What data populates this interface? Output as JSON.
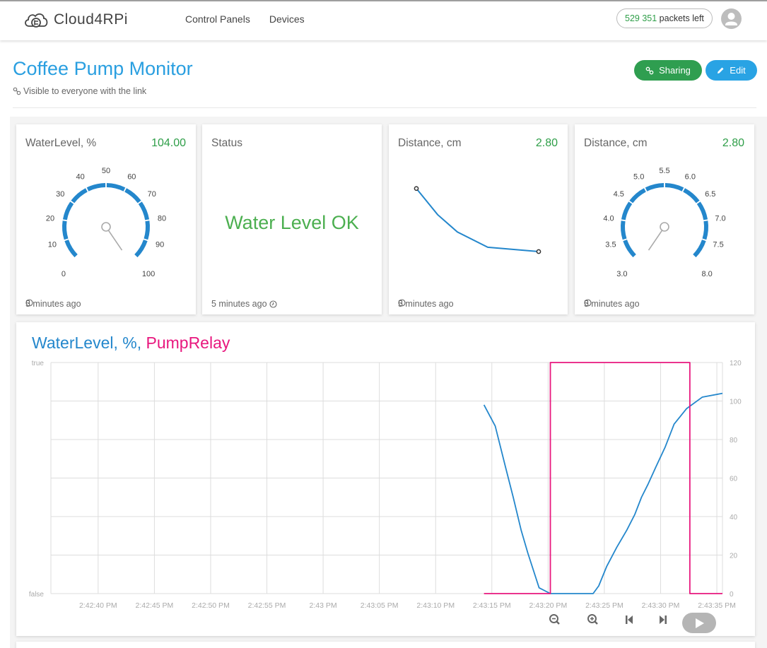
{
  "header": {
    "brand": "Cloud4RPi",
    "logo_icon": "cloud-plug-icon",
    "nav": [
      {
        "label": "Control Panels"
      },
      {
        "label": "Devices"
      }
    ],
    "packets": {
      "count": "529 351",
      "suffix": " packets left"
    },
    "avatar_icon": "user-avatar-icon"
  },
  "page": {
    "title": "Coffee Pump Monitor",
    "visibility": "Visible to everyone with the link",
    "visibility_icon": "link-icon",
    "buttons": {
      "sharing": {
        "label": "Sharing",
        "icon": "link-icon",
        "color": "#2f9e50"
      },
      "edit": {
        "label": "Edit",
        "icon": "pencil-icon",
        "color": "#29a3e4"
      }
    }
  },
  "widgets": [
    {
      "type": "gauge",
      "title": "WaterLevel, %",
      "value": "104.00",
      "numeric_value": 104,
      "min": 0,
      "max": 100,
      "tick_labels": [
        "0",
        "10",
        "20",
        "30",
        "40",
        "50",
        "60",
        "70",
        "80",
        "90",
        "100"
      ],
      "updated": "5 minutes ago"
    },
    {
      "type": "text",
      "title": "Status",
      "text": "Water Level OK",
      "updated": "5 minutes ago"
    },
    {
      "type": "sparkline",
      "title": "Distance, cm",
      "value": "2.80",
      "points": [
        4.5,
        3.9,
        3.5,
        3.15,
        3.05
      ],
      "updated": "5 minutes ago"
    },
    {
      "type": "gauge",
      "title": "Distance, cm",
      "value": "2.80",
      "numeric_value": 2.8,
      "min": 3.0,
      "max": 8.0,
      "tick_labels": [
        "3.0",
        "3.5",
        "4.0",
        "4.5",
        "5.0",
        "5.5",
        "6.0",
        "6.5",
        "7.0",
        "7.5",
        "8.0"
      ],
      "updated": "5 minutes ago"
    }
  ],
  "colors": {
    "accent_blue": "#2487cc",
    "accent_pink": "#e8177e",
    "value_green": "#2e9e48",
    "status_green": "#4caf50"
  },
  "chart": {
    "controls": [
      {
        "name": "zoom-out",
        "icon": "zoom-out-icon"
      },
      {
        "name": "zoom-in",
        "icon": "zoom-in-icon"
      },
      {
        "name": "skip-back",
        "icon": "skip-to-start-icon"
      },
      {
        "name": "skip-forward",
        "icon": "skip-to-end-icon"
      },
      {
        "name": "play",
        "icon": "play-icon"
      }
    ]
  },
  "chart_data": {
    "type": "line",
    "title_parts": [
      {
        "text": "WaterLevel, %, ",
        "color": "#2487cc"
      },
      {
        "text": "PumpRelay",
        "color": "#e8177e"
      }
    ],
    "x_unit": "seconds after 2:42:35 PM",
    "xlim": [
      0.8,
      60.5
    ],
    "x_ticks": [
      {
        "t": 5,
        "label": "2:42:40 PM"
      },
      {
        "t": 10,
        "label": "2:42:45 PM"
      },
      {
        "t": 15,
        "label": "2:42:50 PM"
      },
      {
        "t": 20,
        "label": "2:42:55 PM"
      },
      {
        "t": 25,
        "label": "2:43 PM"
      },
      {
        "t": 30,
        "label": "2:43:05 PM"
      },
      {
        "t": 35,
        "label": "2:43:10 PM"
      },
      {
        "t": 40,
        "label": "2:43:15 PM"
      },
      {
        "t": 45,
        "label": "2:43:20 PM"
      },
      {
        "t": 50,
        "label": "2:43:25 PM"
      },
      {
        "t": 55,
        "label": "2:43:30 PM"
      },
      {
        "t": 60,
        "label": "2:43:35 PM"
      }
    ],
    "left_axis": {
      "labels": [
        "false",
        "true"
      ]
    },
    "right_axis": {
      "ylim": [
        0,
        120
      ],
      "ticks": [
        0,
        20,
        40,
        60,
        80,
        100,
        120
      ]
    },
    "grid": true,
    "series": [
      {
        "name": "WaterLevel, %",
        "color": "#2487cc",
        "axis": "right",
        "points": [
          [
            39.3,
            98
          ],
          [
            40.3,
            87
          ],
          [
            41.2,
            66
          ],
          [
            41.9,
            50
          ],
          [
            42.6,
            33
          ],
          [
            43.2,
            21
          ],
          [
            44.2,
            3
          ],
          [
            45.2,
            0
          ],
          [
            49.0,
            0
          ],
          [
            49.5,
            4
          ],
          [
            50.2,
            14
          ],
          [
            51.1,
            24
          ],
          [
            52.0,
            33
          ],
          [
            52.7,
            41
          ],
          [
            53.3,
            50
          ],
          [
            53.9,
            57
          ],
          [
            54.6,
            66
          ],
          [
            55.4,
            76
          ],
          [
            56.2,
            88
          ],
          [
            57.3,
            96
          ],
          [
            58.7,
            102
          ],
          [
            60.5,
            104
          ]
        ]
      },
      {
        "name": "PumpRelay",
        "color": "#e8177e",
        "axis": "left",
        "type": "step",
        "points": [
          [
            39.3,
            0
          ],
          [
            45.2,
            0
          ],
          [
            45.2,
            1
          ],
          [
            57.6,
            1
          ],
          [
            57.6,
            0
          ],
          [
            60.5,
            0
          ]
        ]
      }
    ]
  }
}
